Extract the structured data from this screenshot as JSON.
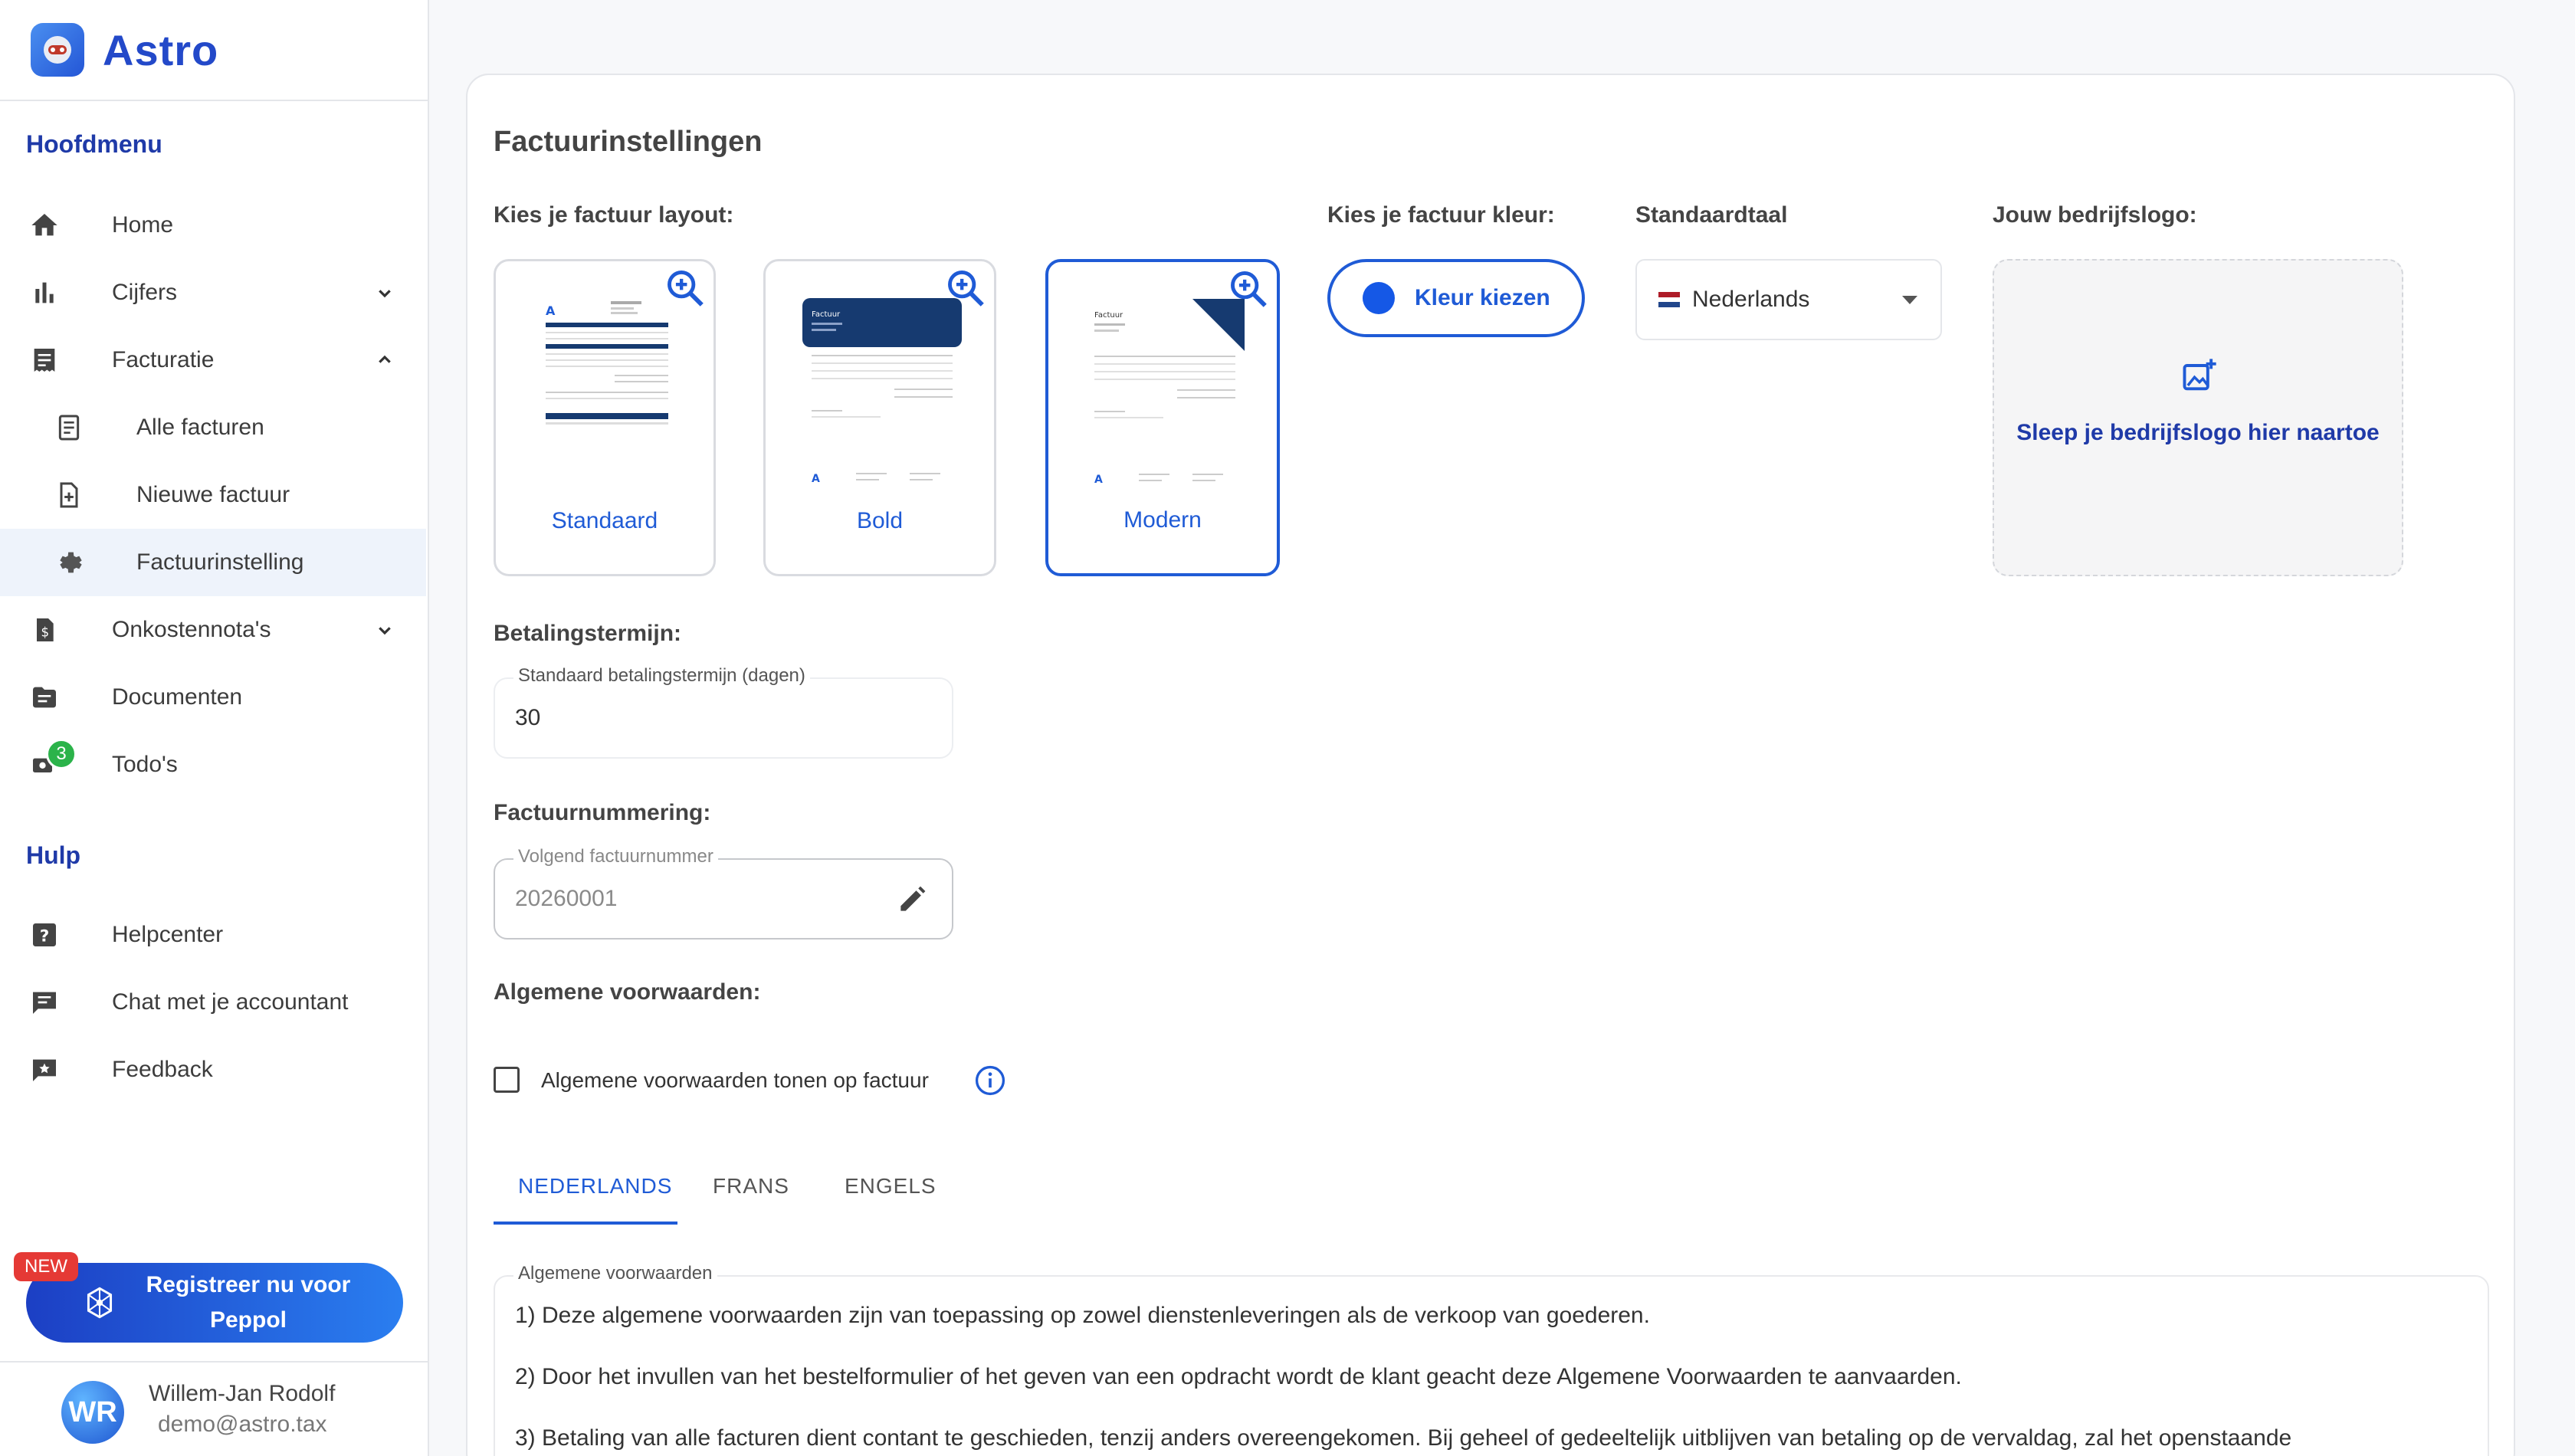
{
  "app": {
    "name": "Astro"
  },
  "sidebar": {
    "main_title": "Hoofdmenu",
    "items": [
      {
        "label": "Home"
      },
      {
        "label": "Cijfers"
      },
      {
        "label": "Facturatie"
      },
      {
        "label": "Alle facturen"
      },
      {
        "label": "Nieuwe factuur"
      },
      {
        "label": "Factuurinstelling"
      },
      {
        "label": "Onkostennota's"
      },
      {
        "label": "Documenten"
      },
      {
        "label": "Todo's",
        "badge": "3"
      }
    ],
    "help_title": "Hulp",
    "help_items": [
      {
        "label": "Helpcenter"
      },
      {
        "label": "Chat met je accountant"
      },
      {
        "label": "Feedback"
      }
    ],
    "peppol": {
      "new_badge": "NEW",
      "line1": "Registreer nu voor",
      "line2": "Peppol"
    },
    "user": {
      "initials": "WR",
      "name": "Willem-Jan Rodolf",
      "email": "demo@astro.tax"
    }
  },
  "settings": {
    "title": "Factuurinstellingen",
    "layout_label": "Kies je factuur layout:",
    "layouts": [
      {
        "name": "Standaard",
        "selected": false
      },
      {
        "name": "Bold",
        "selected": false
      },
      {
        "name": "Modern",
        "selected": true
      }
    ],
    "color_label": "Kies je factuur kleur:",
    "color_button": "Kleur kiezen",
    "color_value": "#1558e6",
    "language_label": "Standaardtaal",
    "language_value": "Nederlands",
    "logo_label": "Jouw bedrijfslogo:",
    "logo_drop_text": "Sleep je bedrijfslogo hier naartoe",
    "payment_label": "Betalingstermijn:",
    "payment_field_label": "Standaard betalingstermijn (dagen)",
    "payment_value": "30",
    "numbering_label": "Factuurnummering:",
    "numbering_field_label": "Volgend factuurnummer",
    "numbering_value": "20260001",
    "terms_label": "Algemene voorwaarden:",
    "terms_checkbox_label": "Algemene voorwaarden tonen op factuur",
    "tabs": [
      "NEDERLANDS",
      "FRANS",
      "ENGELS"
    ],
    "terms_field_label": "Algemene voorwaarden",
    "terms_lines": [
      "1) Deze algemene voorwaarden zijn van toepassing op zowel dienstenleveringen als de verkoop van goederen.",
      "2) Door het invullen van het bestelformulier of het geven van een opdracht wordt de klant geacht deze Algemene Voorwaarden te aanvaarden.",
      "3) Betaling van alle facturen dient contant te geschieden, tenzij anders overeengekomen. Bij geheel of gedeeltelijk uitblijven van betaling op de vervaldag, zal het openstaande"
    ]
  },
  "invoice_preview": {
    "doc_title": "Factuur",
    "logo_letter": "A"
  }
}
